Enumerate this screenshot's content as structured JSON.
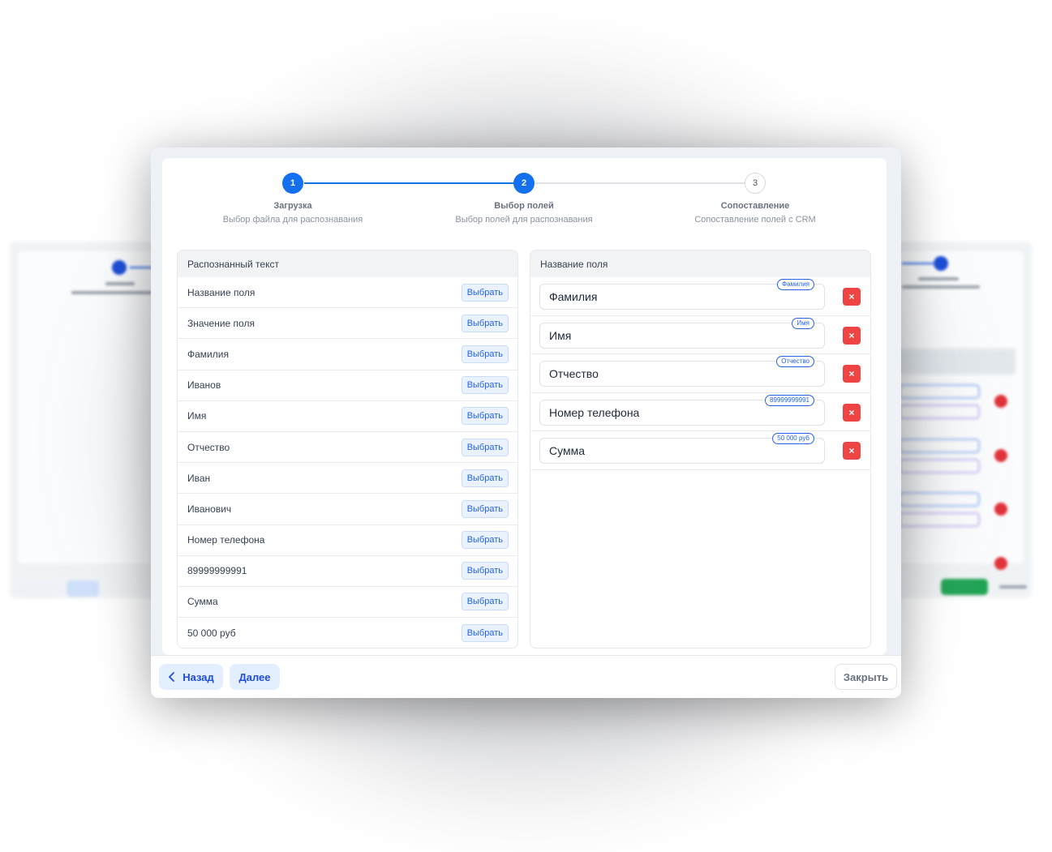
{
  "stepper": {
    "steps": [
      {
        "number": "1",
        "title": "Загрузка",
        "subtitle": "Выбор файла для распознавания"
      },
      {
        "number": "2",
        "title": "Выбор полей",
        "subtitle": "Выбор полей для распознавания"
      },
      {
        "number": "3",
        "title": "Сопоставление",
        "subtitle": "Сопоставление полей с CRM"
      }
    ]
  },
  "left_panel": {
    "header": "Распознанный текст",
    "pick_label": "Выбрать",
    "rows": [
      "Название поля",
      "Значение поля",
      "Фамилия",
      "Иванов",
      "Имя",
      "Отчество",
      "Иван",
      "Иванович",
      "Номер телефона",
      "89999999991",
      "Сумма",
      "50 000 руб"
    ]
  },
  "right_panel": {
    "header": "Название поля",
    "delete_label": "×",
    "fields": [
      {
        "value": "Фамилия",
        "tag": "Фамилия"
      },
      {
        "value": "Имя",
        "tag": "Имя"
      },
      {
        "value": "Отчество",
        "tag": "Отчество"
      },
      {
        "value": "Номер телефона",
        "tag": "89999999991"
      },
      {
        "value": "Сумма",
        "tag": "50 000 руб"
      }
    ]
  },
  "footer": {
    "back_label": "Назад",
    "next_label": "Далее",
    "close_label": "Закрыть"
  },
  "colors": {
    "accent": "#1570ef",
    "danger": "#ef4444"
  }
}
